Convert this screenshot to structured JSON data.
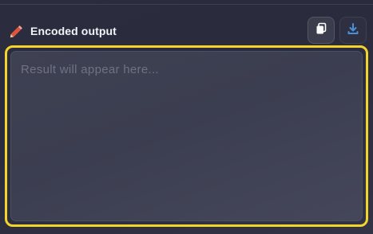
{
  "section": {
    "title": "Encoded output",
    "title_icon": "pencil-icon",
    "actions": [
      {
        "name": "copy-button",
        "icon": "copy-icon"
      },
      {
        "name": "download-button",
        "icon": "download-icon"
      }
    ]
  },
  "output": {
    "placeholder": "Result will appear here...",
    "value": ""
  },
  "colors": {
    "highlight_border": "#f4d42c",
    "download_accent": "#4a90d9",
    "pencil_accent": "#e0533c"
  }
}
